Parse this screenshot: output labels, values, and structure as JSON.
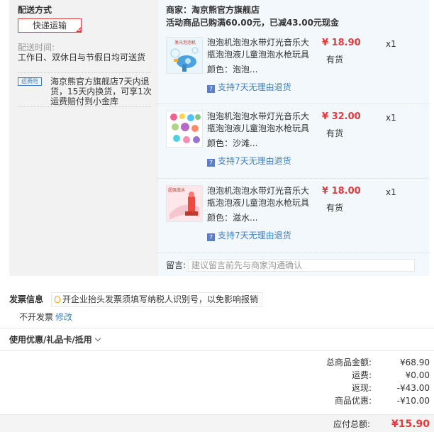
{
  "shipping": {
    "title": "配送方式",
    "method": "快递运输",
    "time_label": "配送时间:",
    "time_value": "工作日、双休日与节假日均可送货",
    "service_logo": "运费险",
    "service_text": "海京熊官方旗舰店7天内退货，15天内换货，可享1次运费赔付到小金库"
  },
  "store": {
    "merchant": "商家：淘京熊官方旗舰店",
    "promo": "活动商品已购满60.00元，已减43.00元现金"
  },
  "items": [
    {
      "name": "泡泡机泡泡水带灯光音乐大瓶泡泡液儿童泡泡水枪玩具",
      "price": "¥ 18.90",
      "stock": "有货",
      "qty": "x1",
      "color": "颜色：泡泡...",
      "return": "支持7天无理由退货",
      "img_caption": "发光泡泡机"
    },
    {
      "name": "泡泡机泡泡水带灯光音乐大瓶泡泡液儿童泡泡水枪玩具",
      "price": "¥ 32.00",
      "stock": "有货",
      "qty": "x1",
      "color": "颜色：沙滩...",
      "return": "支持7天无理由退货",
      "img_caption": ""
    },
    {
      "name": "泡泡机泡泡水带灯光音乐大瓶泡泡液儿童泡泡水枪玩具",
      "price": "¥ 18.00",
      "stock": "有货",
      "qty": "x1",
      "color": "颜色：滋水...",
      "return": "支持7天无理由退货",
      "img_caption": "超强滋水"
    }
  ],
  "note": {
    "label": "留言:",
    "placeholder": "建议留言前先与商家沟通确认"
  },
  "invoice": {
    "title": "发票信息",
    "tip": "开企业抬头发票须填写纳税人识别号，以免影响报销",
    "status": "不开发票",
    "edit": "修改"
  },
  "coupon": {
    "title": "使用优惠/礼品卡/抵用"
  },
  "summary": [
    {
      "label": "总商品金额:",
      "value": "¥68.90"
    },
    {
      "label": "运费:",
      "value": "¥0.00"
    },
    {
      "label": "返现:",
      "value": "-¥43.00"
    },
    {
      "label": "商品优惠:",
      "value": "-¥10.00"
    }
  ],
  "total": {
    "label": "应付总额:",
    "value": "¥15.90"
  },
  "colors": {
    "accent": "#e4393c",
    "link": "#3d7fc4",
    "panel": "#f3f8fd"
  }
}
